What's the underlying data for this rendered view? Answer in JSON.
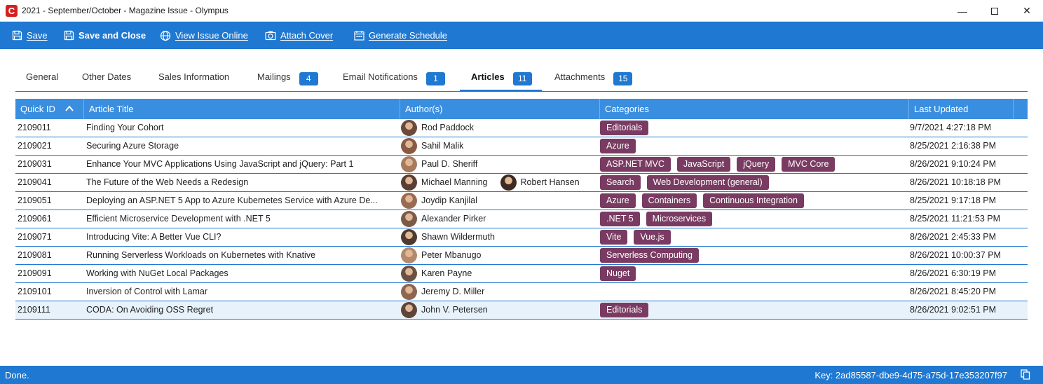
{
  "window": {
    "title": "2021 - September/October - Magazine Issue - Olympus",
    "app_icon": "C",
    "minimize": "—",
    "close": "✕"
  },
  "toolbar": {
    "save": "Save",
    "save_close": "Save and Close",
    "view_online": "View Issue Online",
    "attach_cover": "Attach Cover",
    "generate_schedule": "Generate Schedule"
  },
  "tabs": [
    {
      "label": "General",
      "badge": ""
    },
    {
      "label": "Other Dates",
      "badge": ""
    },
    {
      "label": "Sales Information",
      "badge": ""
    },
    {
      "label": "Mailings",
      "badge": "4"
    },
    {
      "label": "Email Notifications",
      "badge": "1"
    },
    {
      "label": "Articles",
      "badge": "11",
      "active": true
    },
    {
      "label": "Attachments",
      "badge": "15"
    }
  ],
  "grid": {
    "columns": {
      "quick_id": "Quick ID",
      "title": "Article Title",
      "authors": "Author(s)",
      "categories": "Categories",
      "last_updated": "Last Updated"
    },
    "sort": "ascending",
    "rows": [
      {
        "id": "2109011",
        "title": "Finding Your Cohort",
        "authors": [
          "Rod Paddock"
        ],
        "categories": [
          "Editorials"
        ],
        "updated": "9/7/2021 4:27:18 PM"
      },
      {
        "id": "2109021",
        "title": "Securing Azure Storage",
        "authors": [
          "Sahil Malik"
        ],
        "categories": [
          "Azure"
        ],
        "updated": "8/25/2021 2:16:38 PM"
      },
      {
        "id": "2109031",
        "title": "Enhance Your MVC Applications Using JavaScript and jQuery: Part 1",
        "authors": [
          "Paul D. Sheriff"
        ],
        "categories": [
          "ASP.NET MVC",
          "JavaScript",
          "jQuery",
          "MVC Core"
        ],
        "updated": "8/26/2021 9:10:24 PM"
      },
      {
        "id": "2109041",
        "title": "The Future of the Web Needs a Redesign",
        "authors": [
          "Michael Manning",
          "Robert Hansen"
        ],
        "categories": [
          "Search",
          "Web Development (general)"
        ],
        "updated": "8/26/2021 10:18:18 PM"
      },
      {
        "id": "2109051",
        "title": "Deploying an ASP.NET 5 App to Azure Kubernetes Service with Azure De...",
        "authors": [
          "Joydip Kanjilal"
        ],
        "categories": [
          "Azure",
          "Containers",
          "Continuous Integration"
        ],
        "updated": "8/25/2021 9:17:18 PM"
      },
      {
        "id": "2109061",
        "title": "Efficient Microservice Development with .NET 5",
        "authors": [
          "Alexander Pirker"
        ],
        "categories": [
          ".NET 5",
          "Microservices"
        ],
        "updated": "8/25/2021 11:21:53 PM"
      },
      {
        "id": "2109071",
        "title": "Introducing Vite: A Better Vue CLI?",
        "authors": [
          "Shawn Wildermuth"
        ],
        "categories": [
          "Vite",
          "Vue.js"
        ],
        "updated": "8/26/2021 2:45:33 PM"
      },
      {
        "id": "2109081",
        "title": "Running Serverless Workloads on Kubernetes with Knative",
        "authors": [
          "Peter Mbanugo"
        ],
        "categories": [
          "Serverless Computing"
        ],
        "updated": "8/26/2021 10:00:37 PM"
      },
      {
        "id": "2109091",
        "title": "Working with NuGet Local Packages",
        "authors": [
          "Karen Payne"
        ],
        "categories": [
          "Nuget"
        ],
        "updated": "8/26/2021 6:30:19 PM"
      },
      {
        "id": "2109101",
        "title": "Inversion of Control with Lamar",
        "authors": [
          "Jeremy D. Miller"
        ],
        "categories": [],
        "updated": "8/26/2021 8:45:20 PM"
      },
      {
        "id": "2109111",
        "title": "CODA: On Avoiding OSS Regret",
        "authors": [
          "John V. Petersen"
        ],
        "categories": [
          "Editorials"
        ],
        "updated": "8/26/2021 9:02:51 PM",
        "selected": true
      }
    ]
  },
  "status": {
    "message": "Done.",
    "key": "Key: 2ad85587-dbe9-4d75-a75d-17e353207f97"
  },
  "colors": {
    "accent": "#1f78d1",
    "header": "#3a8ee0",
    "tag": "#7a3b62"
  },
  "icons": {
    "save": "save-icon",
    "save_close": "save-icon",
    "view_online": "globe-icon",
    "attach_cover": "camera-icon",
    "generate_schedule": "calendar-icon",
    "copy": "copy-icon"
  }
}
